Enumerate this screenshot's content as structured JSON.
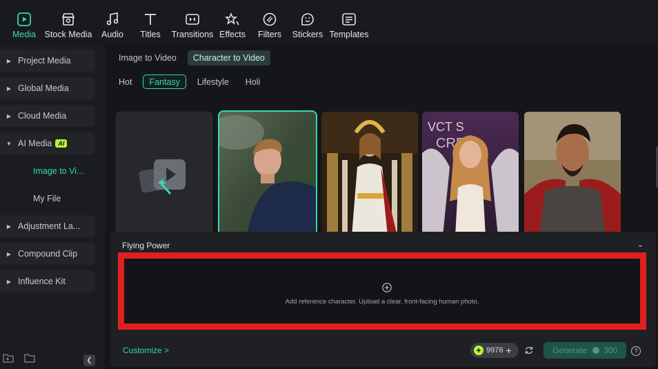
{
  "toolbar": {
    "items": [
      {
        "label": "Media",
        "icon": "media-icon",
        "active": true
      },
      {
        "label": "Stock Media",
        "icon": "stock-media-icon"
      },
      {
        "label": "Audio",
        "icon": "music-note-icon"
      },
      {
        "label": "Titles",
        "icon": "text-t-icon"
      },
      {
        "label": "Transitions",
        "icon": "transitions-icon"
      },
      {
        "label": "Effects",
        "icon": "effects-star-icon"
      },
      {
        "label": "Filters",
        "icon": "filters-icon"
      },
      {
        "label": "Stickers",
        "icon": "sticker-smile-icon"
      },
      {
        "label": "Templates",
        "icon": "templates-icon"
      }
    ]
  },
  "sidebar": {
    "items": [
      {
        "label": "Project Media"
      },
      {
        "label": "Global Media"
      },
      {
        "label": "Cloud Media"
      },
      {
        "label": "AI Media",
        "badge": "AI"
      },
      {
        "label": "Image to Vi..."
      },
      {
        "label": "My File"
      },
      {
        "label": "Adjustment La..."
      },
      {
        "label": "Compound Clip"
      },
      {
        "label": "Influence Kit"
      }
    ]
  },
  "main": {
    "tabs": [
      {
        "label": "Image to Video"
      },
      {
        "label": "Character to Video",
        "active": true
      }
    ],
    "chips": [
      {
        "label": "Hot"
      },
      {
        "label": "Fantasy",
        "active": true
      },
      {
        "label": "Lifestyle"
      },
      {
        "label": "Holi"
      }
    ],
    "thumbnails": [
      {
        "kind": "upload-placeholder"
      },
      {
        "kind": "man-flying",
        "selected": true
      },
      {
        "kind": "goddess-temple"
      },
      {
        "kind": "angel-wings"
      },
      {
        "kind": "gladiator"
      }
    ]
  },
  "panel": {
    "title": "Flying Power",
    "drop_text": "Add reference character. Upload a clear, front-facing human photo.",
    "customize": "Customize >",
    "credits": "9976",
    "generate": "Generate",
    "generate_cost": "300",
    "help": "?"
  },
  "colors": {
    "accent": "#34d9b4",
    "highlight_border": "#e02020",
    "ai_badge": "#b6f533"
  }
}
